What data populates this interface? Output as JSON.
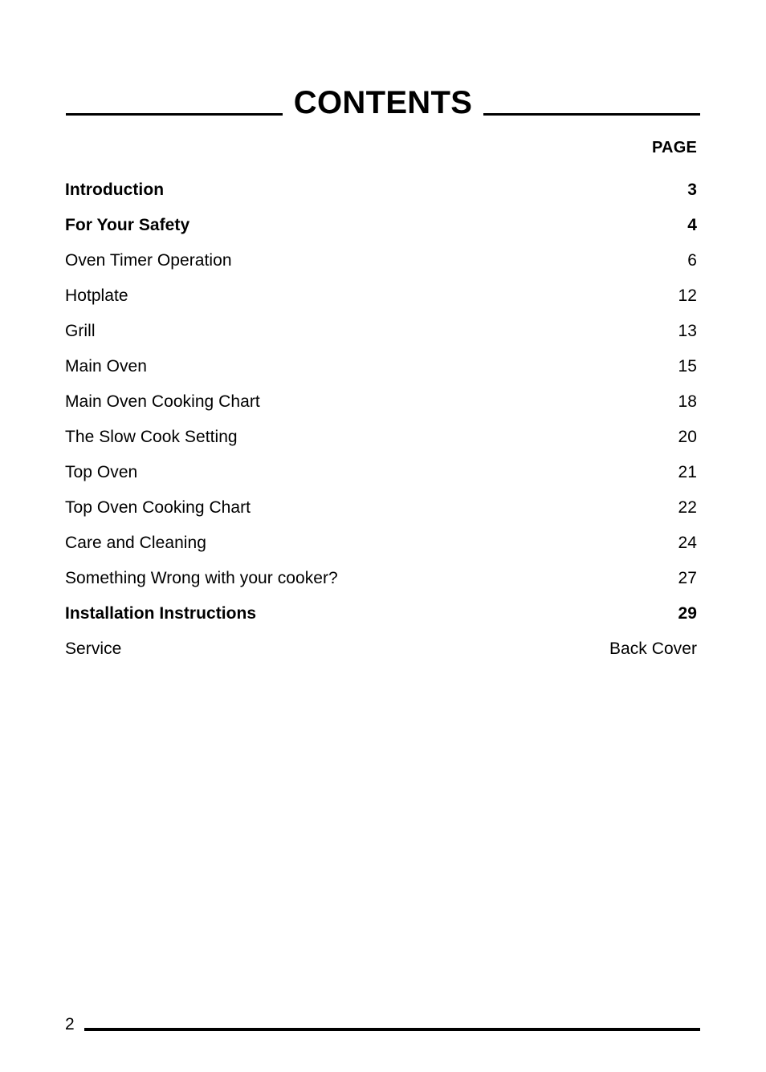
{
  "document": {
    "heading": "CONTENTS",
    "page_number_footer": "2"
  },
  "columns": {
    "page_label": "PAGE"
  },
  "toc": {
    "items": [
      {
        "title": "Introduction",
        "page": "3",
        "bold": true
      },
      {
        "title": "For Your Safety",
        "page": "4",
        "bold": true
      },
      {
        "title": "Oven Timer Operation",
        "page": "6",
        "bold": false
      },
      {
        "title": "Hotplate",
        "page": "12",
        "bold": false
      },
      {
        "title": "Grill",
        "page": "13",
        "bold": false
      },
      {
        "title": "Main Oven",
        "page": "15",
        "bold": false
      },
      {
        "title": "Main Oven Cooking Chart",
        "page": "18",
        "bold": false
      },
      {
        "title": "The Slow Cook Setting",
        "page": "20",
        "bold": false
      },
      {
        "title": "Top Oven",
        "page": "21",
        "bold": false
      },
      {
        "title": "Top Oven Cooking Chart",
        "page": "22",
        "bold": false
      },
      {
        "title": "Care and Cleaning",
        "page": "24",
        "bold": false
      },
      {
        "title": "Something Wrong with your cooker?",
        "page": "27",
        "bold": false
      },
      {
        "title": "Installation Instructions",
        "page": "29",
        "bold": true
      },
      {
        "title": "Service",
        "page": "Back Cover",
        "bold": false
      }
    ]
  },
  "colors": {
    "text": "#000000",
    "background": "#ffffff",
    "rule": "#000000"
  }
}
